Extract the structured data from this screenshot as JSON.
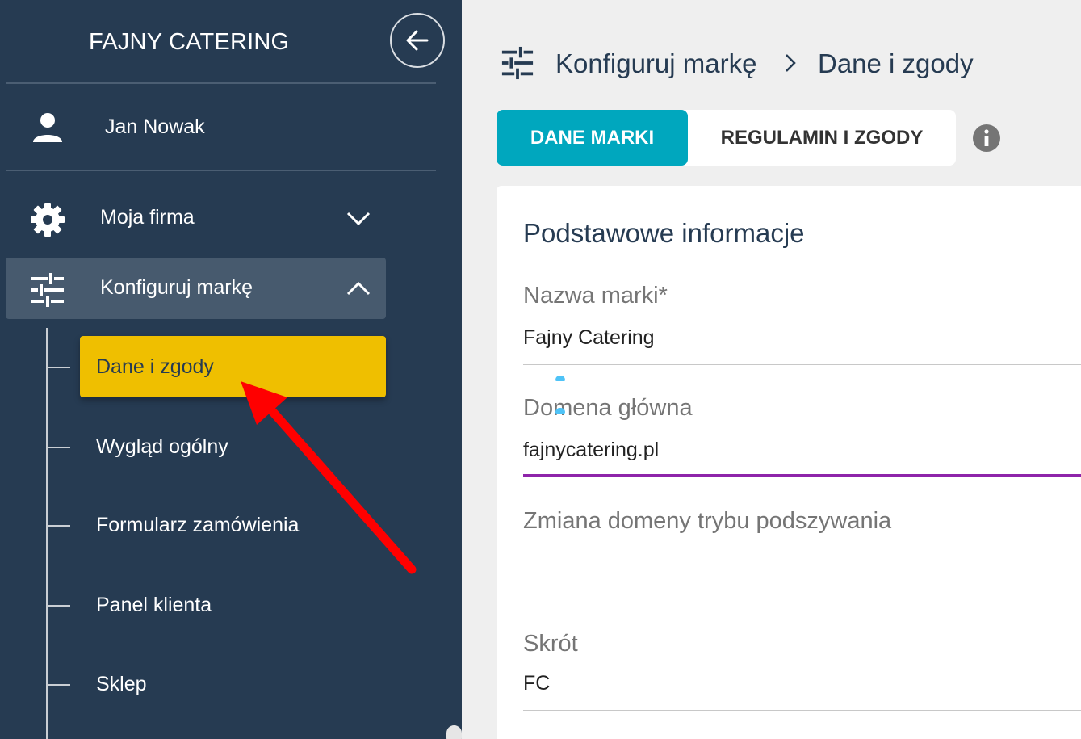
{
  "sidebar": {
    "brand": "FAJNY CATERING",
    "user_name": "Jan Nowak",
    "menu": [
      {
        "label": "Moja firma",
        "icon": "gear-icon"
      },
      {
        "label": "Konfiguruj markę",
        "icon": "sliders-icon"
      }
    ],
    "submenu": [
      {
        "label": "Dane i zgody"
      },
      {
        "label": "Wygląd ogólny"
      },
      {
        "label": "Formularz zamówienia"
      },
      {
        "label": "Panel klienta"
      },
      {
        "label": "Sklep"
      }
    ]
  },
  "breadcrumb": {
    "parent": "Konfiguruj markę",
    "current": "Dane i zgody"
  },
  "tabs": [
    {
      "label": "DANE MARKI",
      "active": true
    },
    {
      "label": "REGULAMIN I ZGODY",
      "active": false
    }
  ],
  "card": {
    "title": "Podstawowe informacje",
    "fields": [
      {
        "label": "Nazwa marki*",
        "value": "Fajny Catering"
      },
      {
        "label": "Domena główna",
        "value": "fajnycatering.pl"
      },
      {
        "label": "Zmiana domeny trybu podszywania",
        "value": ""
      },
      {
        "label": "Skrót",
        "value": "FC"
      }
    ]
  },
  "colors": {
    "sidebar_bg": "#263b52",
    "selected_item": "#efbf00",
    "active_tab": "#00a7be",
    "focus_line": "#8e24aa",
    "annotation_arrow": "#ff0000"
  }
}
